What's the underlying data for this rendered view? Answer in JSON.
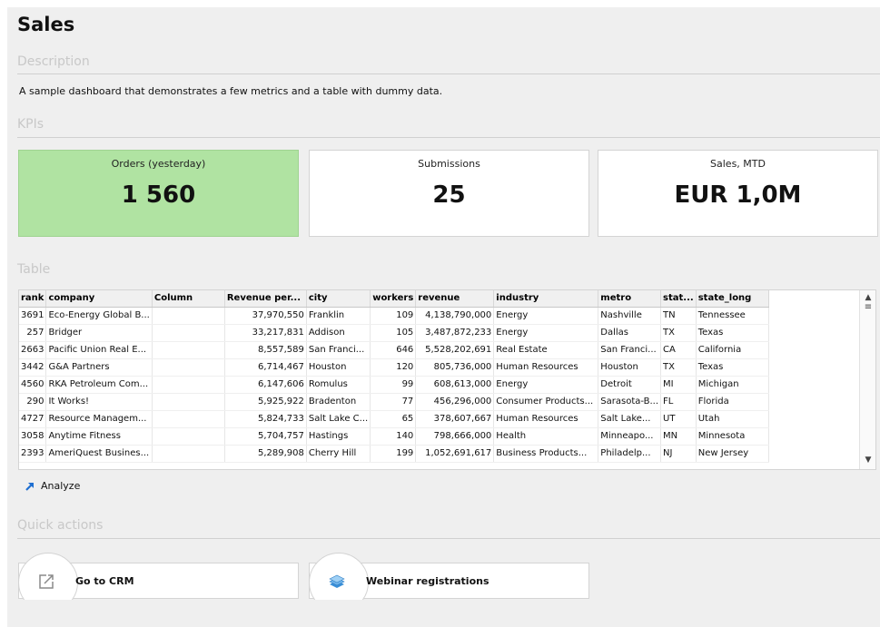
{
  "page": {
    "title": "Sales"
  },
  "sections": {
    "description": "Description",
    "kpis": "KPIs",
    "table": "Table",
    "quick_actions": "Quick actions"
  },
  "description_text": "A sample dashboard that demonstrates a few metrics and a table with dummy data.",
  "kpis": [
    {
      "label": "Orders (yesterday)",
      "value": "1 560",
      "color": "#b0e3a2"
    },
    {
      "label": "Submissions",
      "value": "25"
    },
    {
      "label": "Sales, MTD",
      "value": "EUR 1,0M"
    }
  ],
  "table": {
    "columns": [
      "rank",
      "company",
      "Column",
      "Revenue per...",
      "city",
      "workers",
      "revenue",
      "industry",
      "metro",
      "stat...",
      "state_long"
    ],
    "rows": [
      [
        "3691",
        "Eco-Energy Global B...",
        "",
        "37,970,550",
        "Franklin",
        "109",
        "4,138,790,000",
        "Energy",
        "Nashville",
        "TN",
        "Tennessee"
      ],
      [
        "257",
        "Bridger",
        "",
        "33,217,831",
        "Addison",
        "105",
        "3,487,872,233",
        "Energy",
        "Dallas",
        "TX",
        "Texas"
      ],
      [
        "2663",
        "Pacific Union Real E...",
        "",
        "8,557,589",
        "San Franci...",
        "646",
        "5,528,202,691",
        "Real Estate",
        "San Franci...",
        "CA",
        "California"
      ],
      [
        "3442",
        "G&A Partners",
        "",
        "6,714,467",
        "Houston",
        "120",
        "805,736,000",
        "Human Resources",
        "Houston",
        "TX",
        "Texas"
      ],
      [
        "4560",
        "RKA Petroleum Com...",
        "",
        "6,147,606",
        "Romulus",
        "99",
        "608,613,000",
        "Energy",
        "Detroit",
        "MI",
        "Michigan"
      ],
      [
        "290",
        "It Works!",
        "",
        "5,925,922",
        "Bradenton",
        "77",
        "456,296,000",
        "Consumer Products...",
        "Sarasota-B...",
        "FL",
        "Florida"
      ],
      [
        "4727",
        "Resource Managem...",
        "",
        "5,824,733",
        "Salt Lake C...",
        "65",
        "378,607,667",
        "Human Resources",
        "Salt Lake...",
        "UT",
        "Utah"
      ],
      [
        "3058",
        "Anytime Fitness",
        "",
        "5,704,757",
        "Hastings",
        "140",
        "798,666,000",
        "Health",
        "Minneapo...",
        "MN",
        "Minnesota"
      ],
      [
        "2393",
        "AmeriQuest Busines...",
        "",
        "5,289,908",
        "Cherry Hill",
        "199",
        "1,052,691,617",
        "Business Products...",
        "Philadelp...",
        "NJ",
        "New Jersey"
      ]
    ]
  },
  "analyze_label": "Analyze",
  "quick_actions": [
    {
      "label": "Go to CRM",
      "icon": "external-link-icon"
    },
    {
      "label": "Webinar registrations",
      "icon": "stack-icon"
    }
  ],
  "colors": {
    "accent": "#1f6fd1",
    "kpi_active": "#b0e3a2",
    "background": "#efefef"
  }
}
